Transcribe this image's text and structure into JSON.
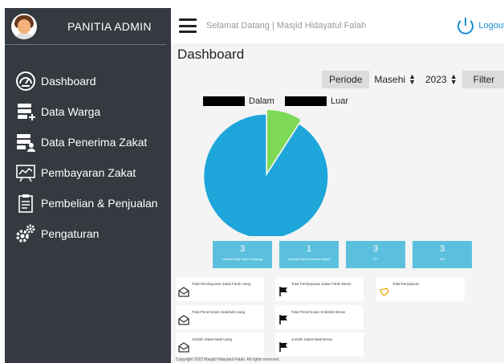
{
  "sidebar": {
    "title": "PANITIA ADMIN",
    "items": [
      {
        "label": "Dashboard",
        "icon": "dashboard-icon"
      },
      {
        "label": "Data Warga",
        "icon": "database-add-icon"
      },
      {
        "label": "Data Penerima Zakat",
        "icon": "database-user-icon"
      },
      {
        "label": "Pembayaran Zakat",
        "icon": "chart-board-icon"
      },
      {
        "label": "Pembelian & Penjualan",
        "icon": "clipboard-icon"
      },
      {
        "label": "Pengaturan",
        "icon": "gears-icon"
      }
    ]
  },
  "topbar": {
    "welcome": "Selamat Datang | Masjid Hidayatul Falah",
    "logout": "Logout"
  },
  "main": {
    "title": "Dashboard",
    "filter": {
      "periode_label": "Periode",
      "calendar": "Masehi",
      "year": "2023",
      "filter_label": "Filter"
    }
  },
  "chart_data": {
    "type": "pie",
    "series": [
      {
        "name": "Dalam",
        "value": 3,
        "color": "#1ea6db"
      },
      {
        "name": "Luar",
        "value": 0.3,
        "color": "#7ed957"
      }
    ]
  },
  "stats": [
    {
      "value": "3",
      "label": "Jumlah Data Kartu Keluarga"
    },
    {
      "value": "1",
      "label": "Jumlah Data Penerima Zakat"
    },
    {
      "value": "3",
      "label": "RT"
    },
    {
      "value": "3",
      "label": "RW"
    }
  ],
  "cards": [
    {
      "label": "Total Pembayaran Zakat Fitrah Uang",
      "icon": "envelope-icon"
    },
    {
      "label": "Total Pembayaran Zakat Fitrah Beras",
      "icon": "flag-icon"
    },
    {
      "label": "Total Penyaluran",
      "icon": "hand-icon"
    },
    {
      "label": "Total Penerimaan Sedekah Uang",
      "icon": "envelope-icon"
    },
    {
      "label": "Total Penerimaan Sedekah Beras",
      "icon": "flag-icon"
    },
    {
      "label": "Jumlah Zakat Maal Uang",
      "icon": "envelope-icon"
    },
    {
      "label": "Jumlah Zakat Maal Beras",
      "icon": "flag-icon"
    }
  ],
  "footer": "Copyright    2022 Masjid Hidayatul Falah. All rights reserved."
}
